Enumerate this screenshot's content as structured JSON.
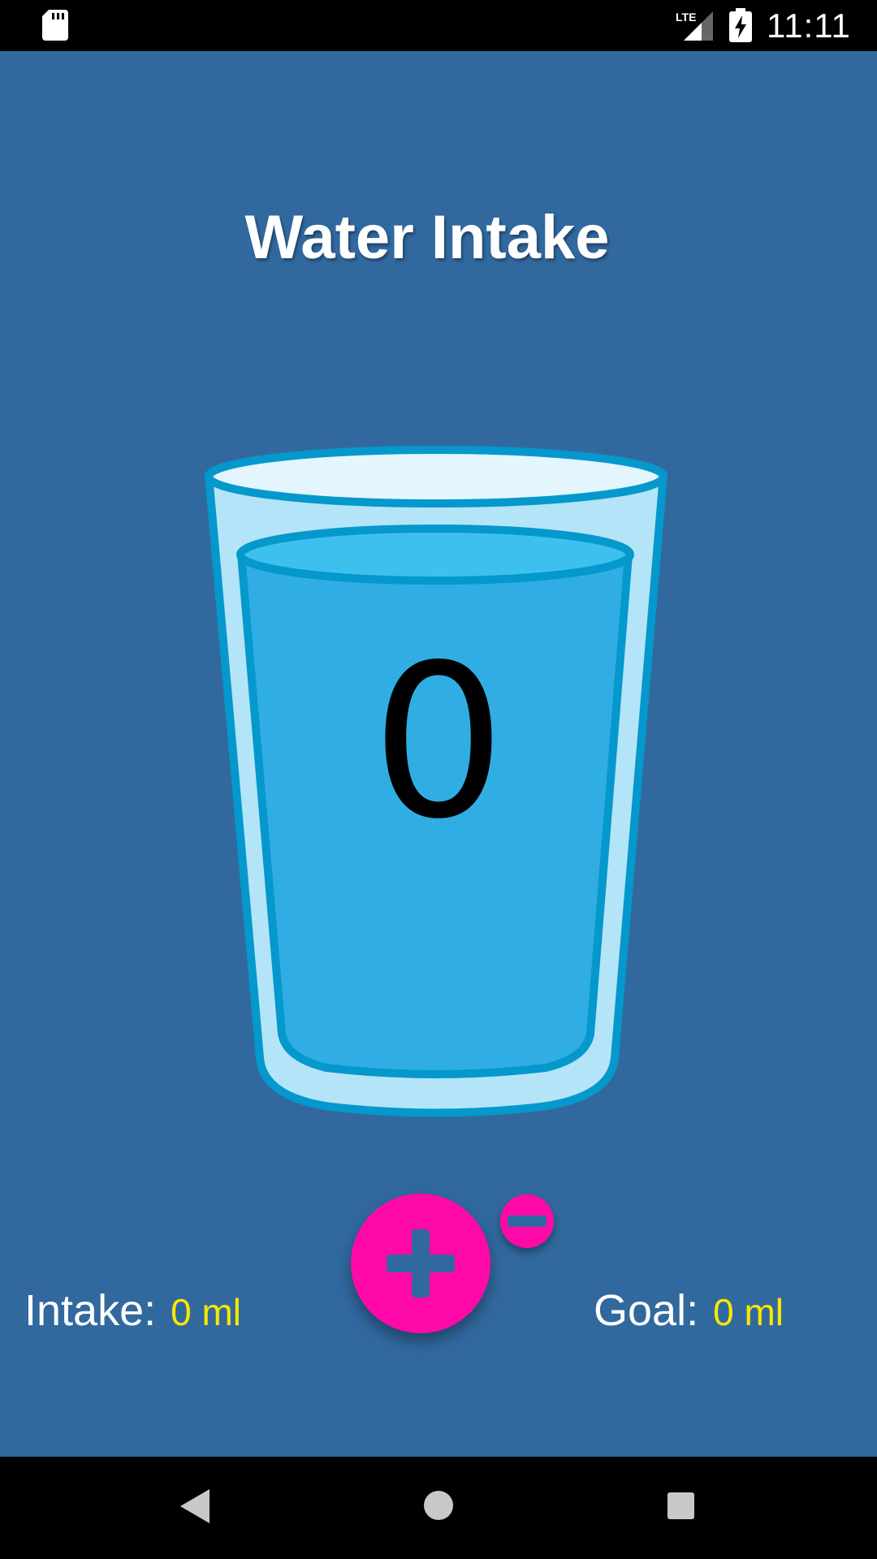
{
  "status_bar": {
    "network_label": "LTE",
    "time": "11:11",
    "icons": [
      "sd-card-icon",
      "lte-signal-icon",
      "battery-charging-icon"
    ]
  },
  "app": {
    "title": "Water Intake",
    "glass_count": "0",
    "plus_button_icon": "plus-icon",
    "minus_button_icon": "minus-icon",
    "intake_label": "Intake:",
    "intake_value": "0 ml",
    "goal_label": "Goal:",
    "goal_value": "0 ml"
  },
  "nav_bar": {
    "icons": [
      "back-icon",
      "home-icon",
      "recents-icon"
    ]
  },
  "colors": {
    "background": "#31699f",
    "accent": "#ff0aa8",
    "value_text": "#ffe600",
    "water": "#30aee3",
    "glass_outline": "#0598cc"
  }
}
